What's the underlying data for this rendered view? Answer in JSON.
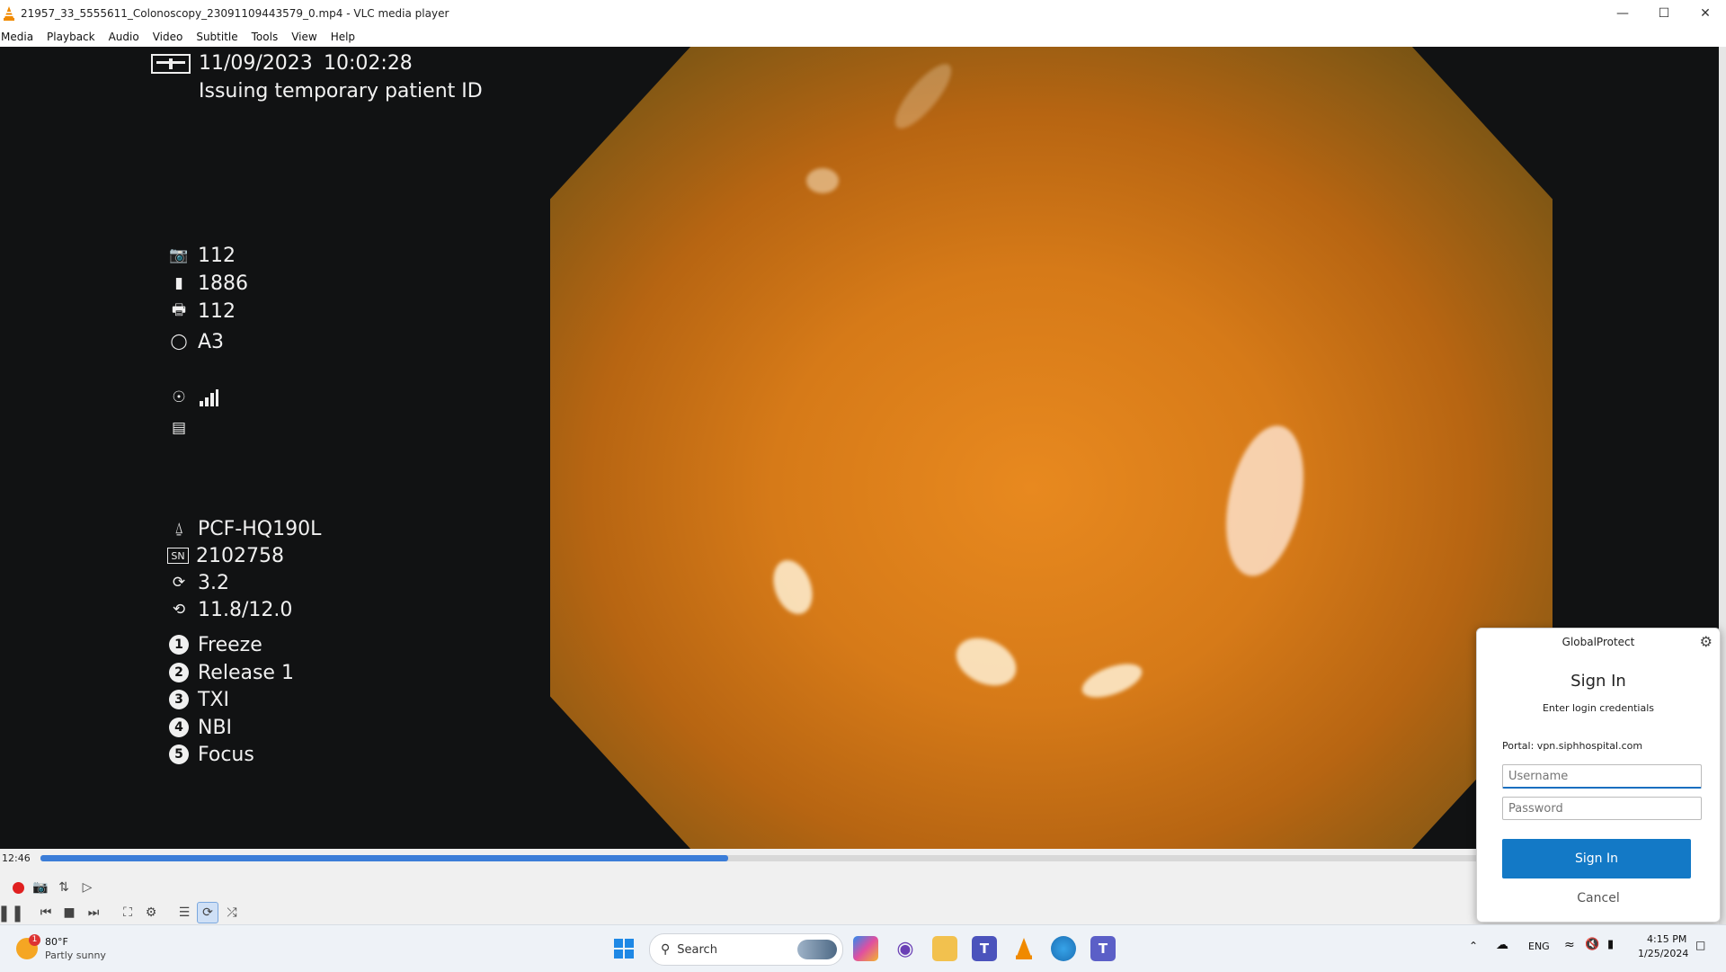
{
  "window": {
    "title": "21957_33_5555611_Colonoscopy_23091109443579_0.mp4 - VLC media player",
    "minimize_icon": "minimize-icon",
    "maximize_icon": "maximize-icon",
    "close_icon": "close-icon"
  },
  "menu": [
    "Media",
    "Playback",
    "Audio",
    "Video",
    "Subtitle",
    "Tools",
    "View",
    "Help"
  ],
  "osd": {
    "date": "11/09/2023",
    "time": "10:02:28",
    "patient_status": "Issuing temporary patient ID",
    "stats": [
      {
        "icon": "camera-icon",
        "value": "112"
      },
      {
        "icon": "battery-icon",
        "value": "1886"
      },
      {
        "icon": "cvp-printer-icon",
        "value": "112"
      },
      {
        "icon": "structure-enhance-icon",
        "value": "A3"
      }
    ],
    "model": "PCF-HQ190L",
    "serial_label": "SN",
    "serial": "2102758",
    "rotation": "3.2",
    "ratio": "11.8/12.0",
    "buttons": [
      {
        "num": "1",
        "label": "Freeze"
      },
      {
        "num": "2",
        "label": "Release 1"
      },
      {
        "num": "3",
        "label": "TXI"
      },
      {
        "num": "4",
        "label": "NBI"
      },
      {
        "num": "5",
        "label": "Focus"
      }
    ]
  },
  "player": {
    "elapsed": "12:46",
    "progress": 0.478
  },
  "globalprotect": {
    "title": "GlobalProtect",
    "heading": "Sign In",
    "subheading": "Enter login credentials",
    "portal": "Portal: vpn.siphhospital.com",
    "username_placeholder": "Username",
    "password_placeholder": "Password",
    "signin_label": "Sign In",
    "cancel_label": "Cancel"
  },
  "taskbar": {
    "weather_temp": "80°F",
    "weather_desc": "Partly sunny",
    "weather_badge": "1",
    "search_placeholder": "Search",
    "language": "ENG",
    "clock_time": "4:15 PM",
    "clock_date": "1/25/2024"
  }
}
